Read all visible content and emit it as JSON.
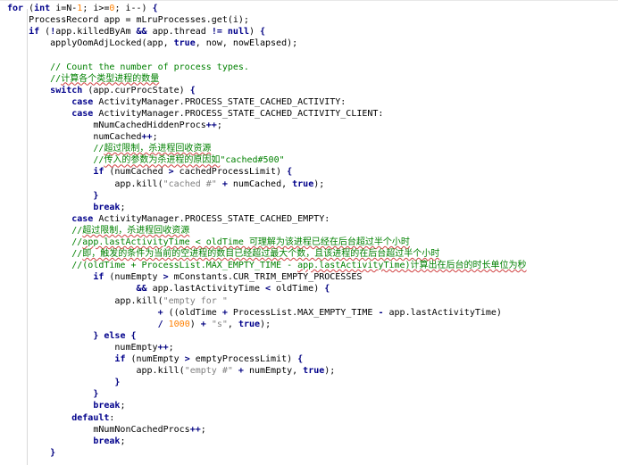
{
  "colors": {
    "keyword": "#00008b",
    "comment": "#008000",
    "number": "#ff8000",
    "string": "#808080",
    "operator": "#000080",
    "default": "#000000"
  },
  "lines": [
    {
      "tokens": [
        {
          "t": "for",
          "c": "kw"
        },
        {
          "t": " ("
        },
        {
          "t": "int",
          "c": "kw"
        },
        {
          "t": " i=N-"
        },
        {
          "t": "1",
          "c": "nm"
        },
        {
          "t": "; i>="
        },
        {
          "t": "0",
          "c": "nm"
        },
        {
          "t": "; i--) "
        },
        {
          "t": "{",
          "c": "op"
        }
      ]
    },
    {
      "tokens": [
        {
          "t": "    ProcessRecord app = mLruProcesses.get(i);"
        }
      ]
    },
    {
      "tokens": [
        {
          "t": "    "
        },
        {
          "t": "if",
          "c": "kw"
        },
        {
          "t": " ("
        },
        {
          "t": "!",
          "c": "op"
        },
        {
          "t": "app.killedByAm "
        },
        {
          "t": "&&",
          "c": "op"
        },
        {
          "t": " app.thread "
        },
        {
          "t": "!=",
          "c": "op"
        },
        {
          "t": " "
        },
        {
          "t": "null",
          "c": "kw"
        },
        {
          "t": ") "
        },
        {
          "t": "{",
          "c": "op"
        }
      ]
    },
    {
      "tokens": [
        {
          "t": "        applyOomAdjLocked(app, "
        },
        {
          "t": "true",
          "c": "kw"
        },
        {
          "t": ", now, nowElapsed);"
        }
      ]
    },
    {
      "tokens": [
        {
          "t": ""
        }
      ]
    },
    {
      "tokens": [
        {
          "t": "        // Count the number of process types.",
          "c": "cm"
        }
      ]
    },
    {
      "tokens": [
        {
          "t": "        //",
          "c": "cm"
        },
        {
          "t": "计算各个类型进程的数量",
          "c": "cm",
          "sq": true
        }
      ]
    },
    {
      "tokens": [
        {
          "t": "        "
        },
        {
          "t": "switch",
          "c": "kw"
        },
        {
          "t": " (app.curProcState) "
        },
        {
          "t": "{",
          "c": "op"
        }
      ]
    },
    {
      "tokens": [
        {
          "t": "            "
        },
        {
          "t": "case",
          "c": "kw"
        },
        {
          "t": " ActivityManager.PROCESS_STATE_CACHED_ACTIVITY:"
        }
      ]
    },
    {
      "tokens": [
        {
          "t": "            "
        },
        {
          "t": "case",
          "c": "kw"
        },
        {
          "t": " ActivityManager.PROCESS_STATE_CACHED_ACTIVITY_CLIENT:"
        }
      ]
    },
    {
      "tokens": [
        {
          "t": "                mNumCachedHiddenProcs"
        },
        {
          "t": "++",
          "c": "op"
        },
        {
          "t": ";"
        }
      ]
    },
    {
      "tokens": [
        {
          "t": "                numCached"
        },
        {
          "t": "++",
          "c": "op"
        },
        {
          "t": ";"
        }
      ]
    },
    {
      "tokens": [
        {
          "t": "                //",
          "c": "cm"
        },
        {
          "t": "超过限制，杀进程回收资源",
          "c": "cm",
          "sq": true
        }
      ]
    },
    {
      "tokens": [
        {
          "t": "                //",
          "c": "cm"
        },
        {
          "t": "传入的参数为杀进程的原因如",
          "c": "cm",
          "sq": true
        },
        {
          "t": "\"cached#500\"",
          "c": "cm"
        }
      ]
    },
    {
      "tokens": [
        {
          "t": "                "
        },
        {
          "t": "if",
          "c": "kw"
        },
        {
          "t": " (numCached "
        },
        {
          "t": ">",
          "c": "op"
        },
        {
          "t": " cachedProcessLimit) "
        },
        {
          "t": "{",
          "c": "op"
        }
      ]
    },
    {
      "tokens": [
        {
          "t": "                    app.kill("
        },
        {
          "t": "\"cached #\"",
          "c": "st"
        },
        {
          "t": " "
        },
        {
          "t": "+",
          "c": "op"
        },
        {
          "t": " numCached, "
        },
        {
          "t": "true",
          "c": "kw"
        },
        {
          "t": ");"
        }
      ]
    },
    {
      "tokens": [
        {
          "t": "                "
        },
        {
          "t": "}",
          "c": "op"
        }
      ]
    },
    {
      "tokens": [
        {
          "t": "                "
        },
        {
          "t": "break",
          "c": "kw"
        },
        {
          "t": ";"
        }
      ]
    },
    {
      "tokens": [
        {
          "t": "            "
        },
        {
          "t": "case",
          "c": "kw"
        },
        {
          "t": " ActivityManager.PROCESS_STATE_CACHED_EMPTY:"
        }
      ]
    },
    {
      "tokens": [
        {
          "t": "            //",
          "c": "cm"
        },
        {
          "t": "超过限制，杀进程回收资源",
          "c": "cm",
          "sq": true
        }
      ]
    },
    {
      "tokens": [
        {
          "t": "            //",
          "c": "cm"
        },
        {
          "t": "app.lastActivityTime < oldTime ",
          "c": "cm",
          "sq": true
        },
        {
          "t": "可理解为该进程已经在后台超过半个小时",
          "c": "cm",
          "sq": true
        }
      ]
    },
    {
      "tokens": [
        {
          "t": "            //",
          "c": "cm"
        },
        {
          "t": "即，触发的条件为当前的空进程的数目已经超过最大个数，且该进程的在后台超过半个小时",
          "c": "cm",
          "sq": true
        }
      ]
    },
    {
      "tokens": [
        {
          "t": "            //(oldTime + ProcessList.MAX_EMPTY_TIME - ",
          "c": "cm"
        },
        {
          "t": "app.lastActivityTime)",
          "c": "cm",
          "sq": true
        },
        {
          "t": "计算出在后台的时长单位为秒",
          "c": "cm",
          "sq": true
        }
      ]
    },
    {
      "tokens": [
        {
          "t": "                "
        },
        {
          "t": "if",
          "c": "kw"
        },
        {
          "t": " (numEmpty "
        },
        {
          "t": ">",
          "c": "op"
        },
        {
          "t": " mConstants.CUR_TRIM_EMPTY_PROCESSES"
        }
      ]
    },
    {
      "tokens": [
        {
          "t": "                        "
        },
        {
          "t": "&&",
          "c": "op"
        },
        {
          "t": " app.lastActivityTime "
        },
        {
          "t": "<",
          "c": "op"
        },
        {
          "t": " oldTime) "
        },
        {
          "t": "{",
          "c": "op"
        }
      ]
    },
    {
      "tokens": [
        {
          "t": "                    app.kill("
        },
        {
          "t": "\"empty for \"",
          "c": "st"
        }
      ]
    },
    {
      "tokens": [
        {
          "t": "                            "
        },
        {
          "t": "+",
          "c": "op"
        },
        {
          "t": " ((oldTime "
        },
        {
          "t": "+",
          "c": "op"
        },
        {
          "t": " ProcessList.MAX_EMPTY_TIME "
        },
        {
          "t": "-",
          "c": "op"
        },
        {
          "t": " app.lastActivityTime)"
        }
      ]
    },
    {
      "tokens": [
        {
          "t": "                            "
        },
        {
          "t": "/",
          "c": "op"
        },
        {
          "t": " "
        },
        {
          "t": "1000",
          "c": "nm"
        },
        {
          "t": ") "
        },
        {
          "t": "+",
          "c": "op"
        },
        {
          "t": " "
        },
        {
          "t": "\"s\"",
          "c": "st"
        },
        {
          "t": ", "
        },
        {
          "t": "true",
          "c": "kw"
        },
        {
          "t": ");"
        }
      ]
    },
    {
      "tokens": [
        {
          "t": "                "
        },
        {
          "t": "}",
          "c": "op"
        },
        {
          "t": " "
        },
        {
          "t": "else",
          "c": "kw"
        },
        {
          "t": " "
        },
        {
          "t": "{",
          "c": "op"
        }
      ]
    },
    {
      "tokens": [
        {
          "t": "                    numEmpty"
        },
        {
          "t": "++",
          "c": "op"
        },
        {
          "t": ";"
        }
      ]
    },
    {
      "tokens": [
        {
          "t": "                    "
        },
        {
          "t": "if",
          "c": "kw"
        },
        {
          "t": " (numEmpty "
        },
        {
          "t": ">",
          "c": "op"
        },
        {
          "t": " emptyProcessLimit) "
        },
        {
          "t": "{",
          "c": "op"
        }
      ]
    },
    {
      "tokens": [
        {
          "t": "                        app.kill("
        },
        {
          "t": "\"empty #\"",
          "c": "st"
        },
        {
          "t": " "
        },
        {
          "t": "+",
          "c": "op"
        },
        {
          "t": " numEmpty, "
        },
        {
          "t": "true",
          "c": "kw"
        },
        {
          "t": ");"
        }
      ]
    },
    {
      "tokens": [
        {
          "t": "                    "
        },
        {
          "t": "}",
          "c": "op"
        }
      ]
    },
    {
      "tokens": [
        {
          "t": "                "
        },
        {
          "t": "}",
          "c": "op"
        }
      ]
    },
    {
      "tokens": [
        {
          "t": "                "
        },
        {
          "t": "break",
          "c": "kw"
        },
        {
          "t": ";"
        }
      ]
    },
    {
      "tokens": [
        {
          "t": "            "
        },
        {
          "t": "default",
          "c": "kw"
        },
        {
          "t": ":"
        }
      ]
    },
    {
      "tokens": [
        {
          "t": "                mNumNonCachedProcs"
        },
        {
          "t": "++",
          "c": "op"
        },
        {
          "t": ";"
        }
      ]
    },
    {
      "tokens": [
        {
          "t": "                "
        },
        {
          "t": "break",
          "c": "kw"
        },
        {
          "t": ";"
        }
      ]
    },
    {
      "tokens": [
        {
          "t": "        "
        },
        {
          "t": "}",
          "c": "op"
        }
      ]
    }
  ]
}
